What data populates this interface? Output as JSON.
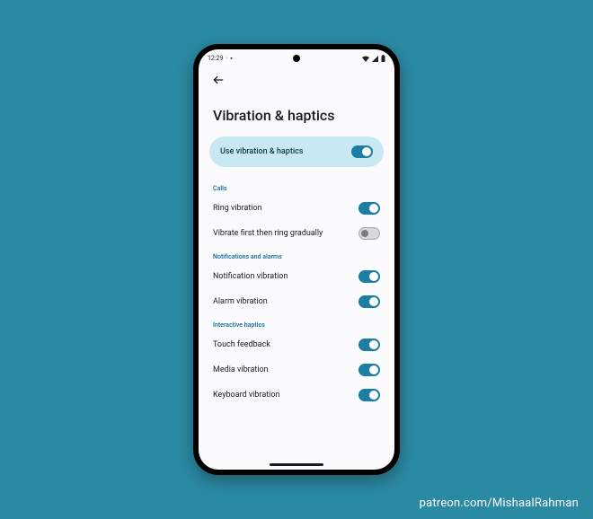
{
  "status": {
    "time": "12:29",
    "wifi_icon": "▾",
    "signal_icon": "◢",
    "battery_icon": "▮"
  },
  "header": {
    "title": "Vibration & haptics"
  },
  "master": {
    "label": "Use vibration & haptics",
    "on": true
  },
  "sections": [
    {
      "header": "Calls",
      "items": [
        {
          "label": "Ring vibration",
          "on": true
        },
        {
          "label": "Vibrate first then ring gradually",
          "on": false
        }
      ]
    },
    {
      "header": "Notifications and alarms",
      "items": [
        {
          "label": "Notification vibration",
          "on": true
        },
        {
          "label": "Alarm vibration",
          "on": true
        }
      ]
    },
    {
      "header": "Interactive haptics",
      "items": [
        {
          "label": "Touch feedback",
          "on": true
        },
        {
          "label": "Media vibration",
          "on": true
        },
        {
          "label": "Keyboard vibration",
          "on": true
        }
      ]
    }
  ],
  "credit": "patreon.com/MishaalRahman"
}
